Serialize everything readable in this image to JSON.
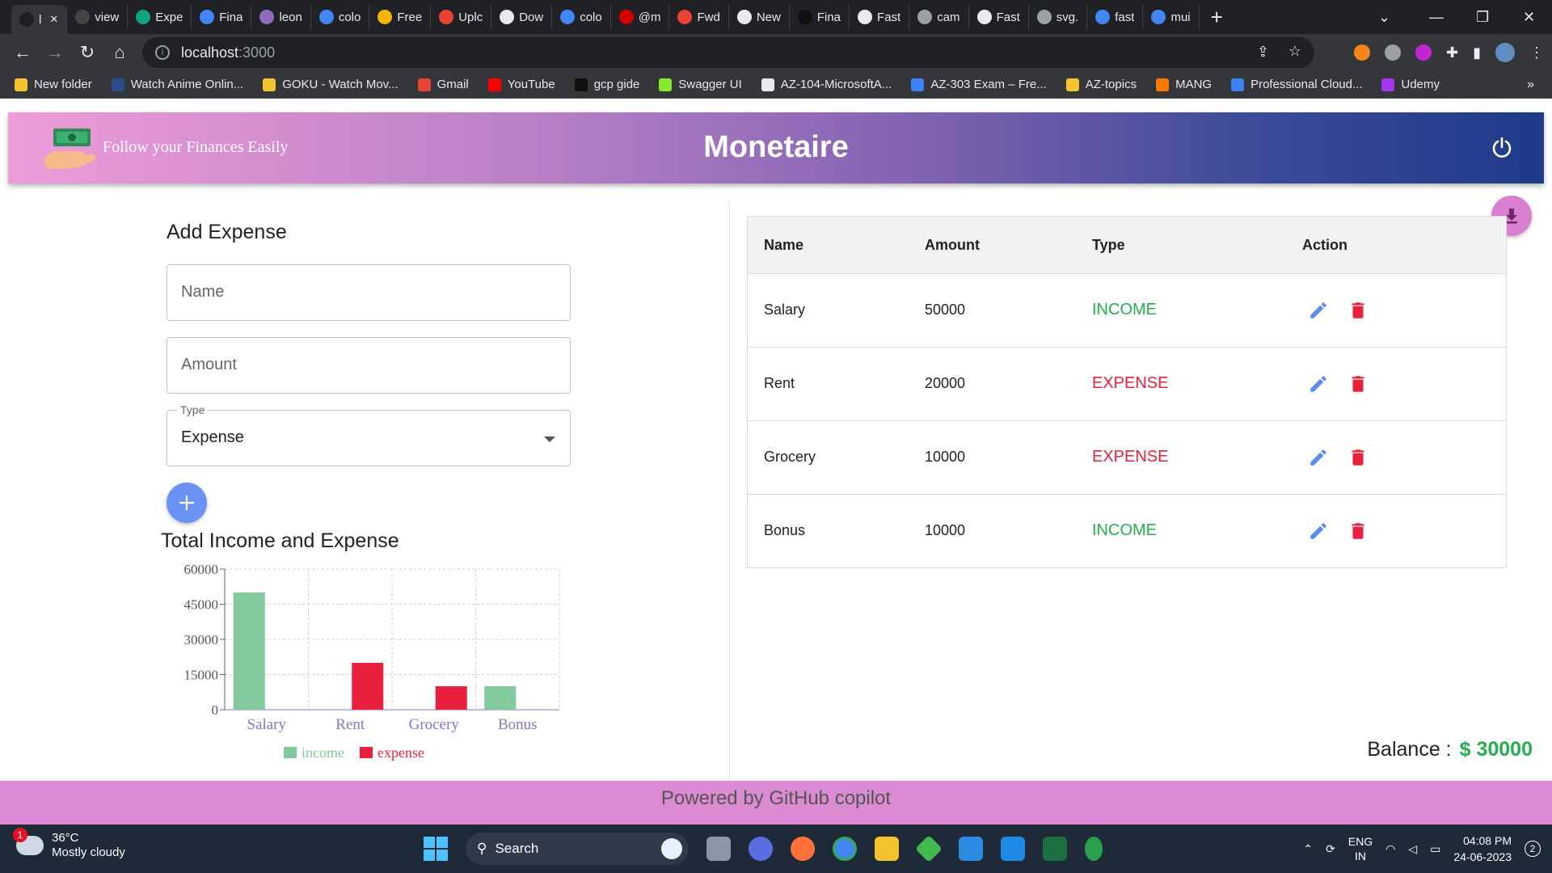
{
  "browser": {
    "tabs": [
      {
        "label": "l",
        "color": "#202124",
        "active": true
      },
      {
        "label": "view",
        "color": "#444"
      },
      {
        "label": "Expe",
        "color": "#10a37f"
      },
      {
        "label": "Fina",
        "color": "#4285f4"
      },
      {
        "label": "leon",
        "color": "#8e6dbf"
      },
      {
        "label": "colo",
        "color": "#4285f4"
      },
      {
        "label": "Free",
        "color": "#f4b400"
      },
      {
        "label": "Uplc",
        "color": "#ea4335"
      },
      {
        "label": "Dow",
        "color": "#e8eaed"
      },
      {
        "label": "colo",
        "color": "#4285f4"
      },
      {
        "label": "@m",
        "color": "#d50000"
      },
      {
        "label": "Fwd",
        "color": "#ea4335"
      },
      {
        "label": "New",
        "color": "#e8eaed"
      },
      {
        "label": "Fina",
        "color": "#111"
      },
      {
        "label": "Fast",
        "color": "#e8eaed"
      },
      {
        "label": "cam",
        "color": "#9aa0a6"
      },
      {
        "label": "Fast",
        "color": "#e8eaed"
      },
      {
        "label": "svg.",
        "color": "#9aa0a6"
      },
      {
        "label": "fast",
        "color": "#4285f4"
      },
      {
        "label": "mui",
        "color": "#4285f4"
      }
    ],
    "url_host": "localhost",
    "url_port": ":3000",
    "bookmarks": [
      {
        "label": "New folder",
        "color": "#f4c430"
      },
      {
        "label": "Watch Anime Onlin...",
        "color": "#2b4b8f"
      },
      {
        "label": "GOKU - Watch Mov...",
        "color": "#f4c430"
      },
      {
        "label": "Gmail",
        "color": "#ea4335"
      },
      {
        "label": "YouTube",
        "color": "#ff0000"
      },
      {
        "label": "gcp gide",
        "color": "#111"
      },
      {
        "label": "Swagger UI",
        "color": "#85ea2d"
      },
      {
        "label": "AZ-104-MicrosoftA...",
        "color": "#e8eaed"
      },
      {
        "label": "AZ-303 Exam – Fre...",
        "color": "#3b82f6"
      },
      {
        "label": "AZ-topics",
        "color": "#f4c430"
      },
      {
        "label": "MANG",
        "color": "#ff7a00"
      },
      {
        "label": "Professional Cloud...",
        "color": "#3b82f6"
      },
      {
        "label": "Udemy",
        "color": "#a435f0"
      }
    ],
    "bookmarks_more": "»"
  },
  "header": {
    "tagline": "Follow your Finances Easily",
    "title": "Monetaire"
  },
  "form": {
    "title": "Add Expense",
    "name_placeholder": "Name",
    "amount_placeholder": "Amount",
    "type_label": "Type",
    "type_value": "Expense"
  },
  "chart_title": "Total Income and Expense",
  "chart_data": {
    "type": "bar",
    "categories": [
      "Salary",
      "Rent",
      "Grocery",
      "Bonus"
    ],
    "series": [
      {
        "name": "income",
        "values": [
          50000,
          0,
          0,
          10000
        ],
        "color": "#82ca9d"
      },
      {
        "name": "expense",
        "values": [
          0,
          20000,
          10000,
          0
        ],
        "color": "#e8203d"
      }
    ],
    "yticks": [
      0,
      15000,
      30000,
      45000,
      60000
    ],
    "ylim": [
      0,
      60000
    ],
    "grid": true,
    "legend": "bottom"
  },
  "table": {
    "headers": {
      "name": "Name",
      "amount": "Amount",
      "type": "Type",
      "action": "Action"
    },
    "rows": [
      {
        "name": "Salary",
        "amount": "50000",
        "type": "INCOME",
        "type_color": "#22b14c"
      },
      {
        "name": "Rent",
        "amount": "20000",
        "type": "EXPENSE",
        "type_color": "#e8203d"
      },
      {
        "name": "Grocery",
        "amount": "10000",
        "type": "EXPENSE",
        "type_color": "#e8203d"
      },
      {
        "name": "Bonus",
        "amount": "10000",
        "type": "INCOME",
        "type_color": "#22b14c"
      }
    ]
  },
  "balance": {
    "label": "Balance :",
    "amount": "$ 30000"
  },
  "footer": "Powered by GitHub copilot",
  "taskbar": {
    "weather_temp": "36°C",
    "weather_desc": "Mostly cloudy",
    "weather_badge": "1",
    "search_label": "Search",
    "lang_top": "ENG",
    "lang_bottom": "IN",
    "time": "04:08 PM",
    "date": "24-06-2023",
    "notifications": "2"
  },
  "colors": {
    "income": "#22b14c",
    "expense": "#e8203d",
    "accent": "#6a92f5"
  }
}
